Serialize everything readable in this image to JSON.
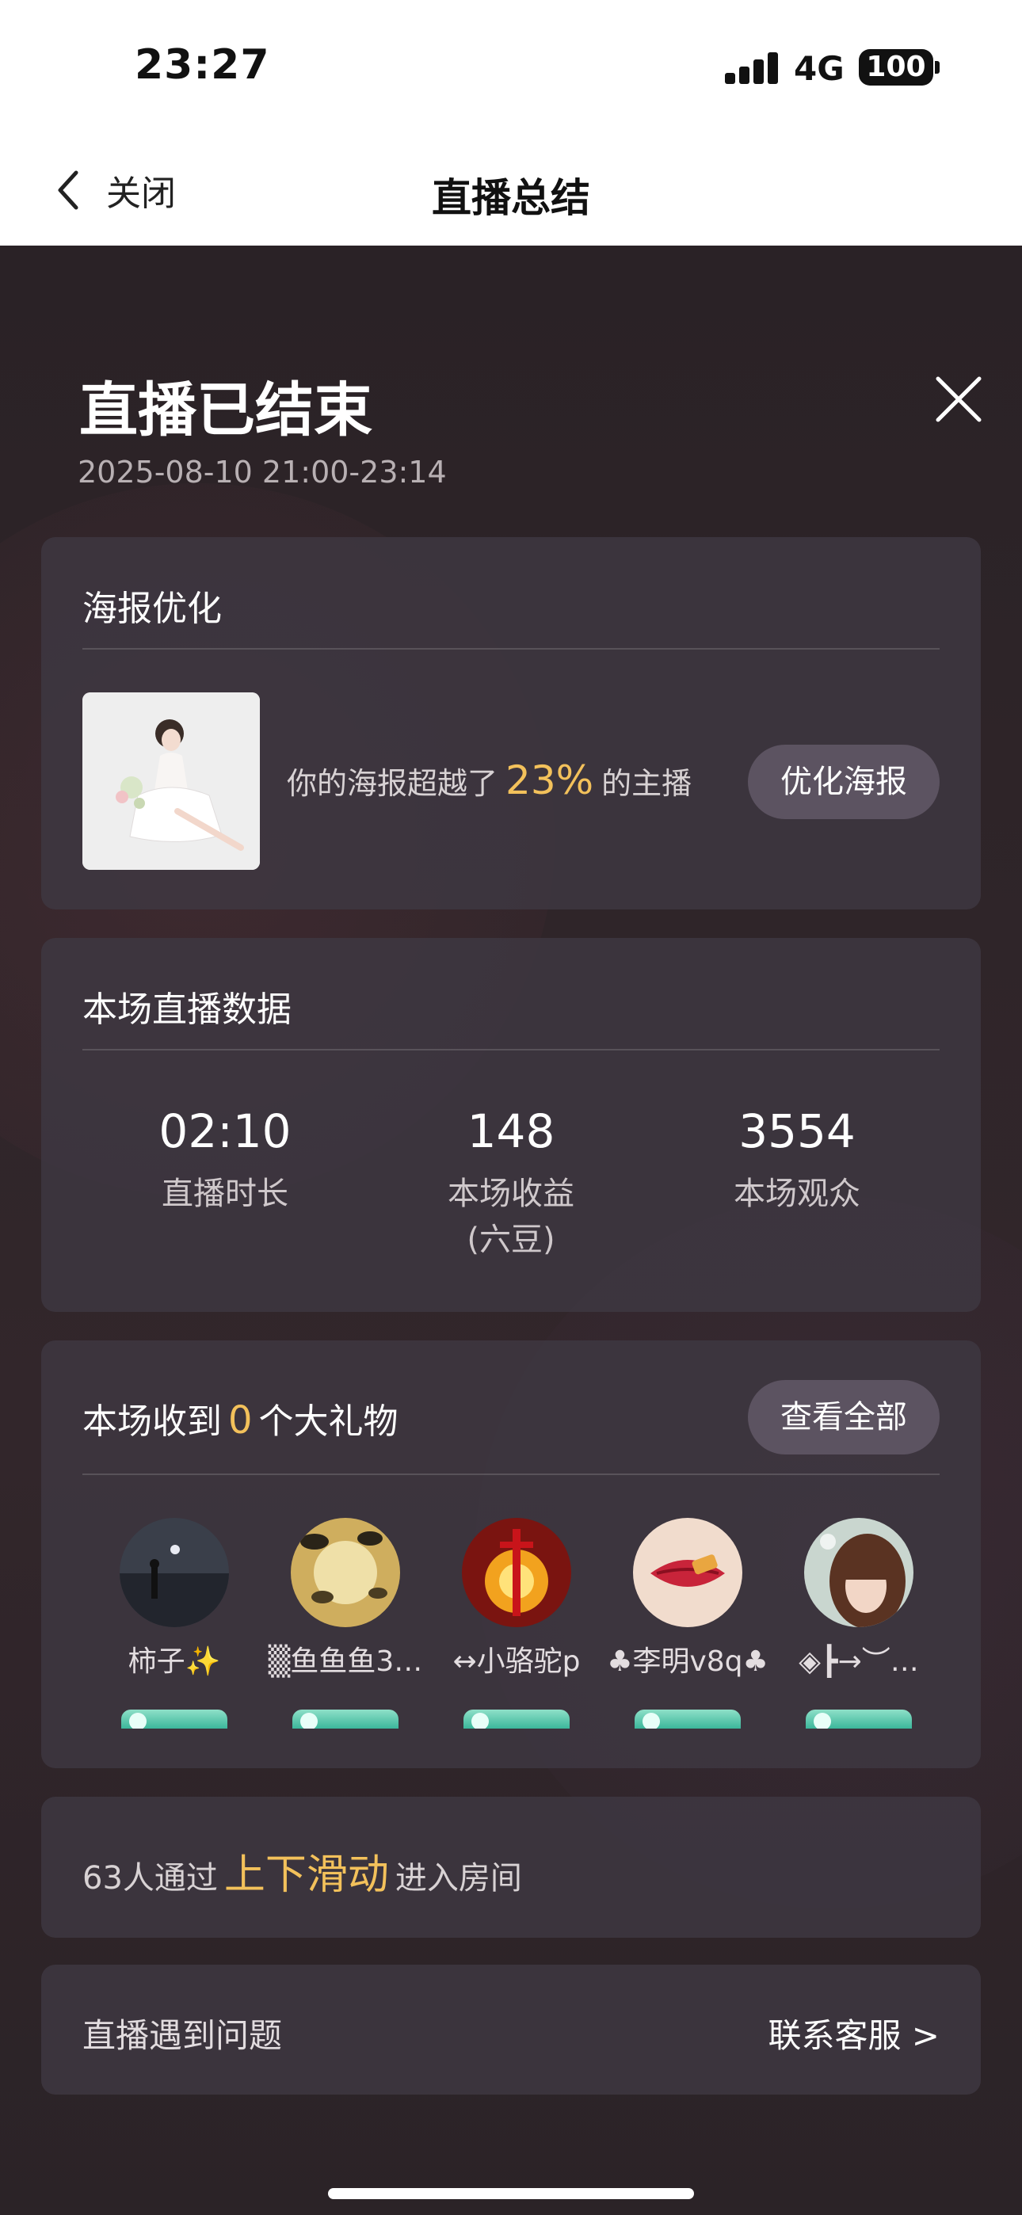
{
  "status_bar": {
    "time": "23:27",
    "network": "4G",
    "battery": "100"
  },
  "nav": {
    "back_label": "关闭",
    "title": "直播总结"
  },
  "header": {
    "title": "直播已结束",
    "time_range": "2025-08-10 21:00-23:14"
  },
  "poster": {
    "title": "海报优化",
    "text_prefix": "你的海报超越了",
    "percent": "23%",
    "text_suffix": "的主播",
    "button": "优化海报"
  },
  "stats": {
    "title": "本场直播数据",
    "items": [
      {
        "value": "02:10",
        "label": "直播时长",
        "sublabel": ""
      },
      {
        "value": "148",
        "label": "本场收益",
        "sublabel": "(六豆)"
      },
      {
        "value": "3554",
        "label": "本场观众",
        "sublabel": ""
      }
    ]
  },
  "gifts": {
    "title_prefix": "本场收到",
    "count": "0",
    "title_suffix": "个大礼物",
    "view_all": "查看全部",
    "gifters": [
      {
        "name": "柿子✨",
        "avatar": "night-silhouette-avatar"
      },
      {
        "name": "▒鱼鱼鱼3…",
        "avatar": "floating-islands-avatar"
      },
      {
        "name": "↔小骆驼p",
        "avatar": "flaming-sword-avatar"
      },
      {
        "name": "♣李明v8q♣",
        "avatar": "lips-avatar"
      },
      {
        "name": "◈┣→︶…",
        "avatar": "girl-portrait-avatar"
      }
    ]
  },
  "swipe": {
    "prefix": "63人通过",
    "highlight": "上下滑动",
    "suffix": "进入房间"
  },
  "support": {
    "text": "直播遇到问题",
    "link": "联系客服 >"
  },
  "colors": {
    "accent": "#f3c15b",
    "card": "#3e3842",
    "button": "#5c5361"
  }
}
